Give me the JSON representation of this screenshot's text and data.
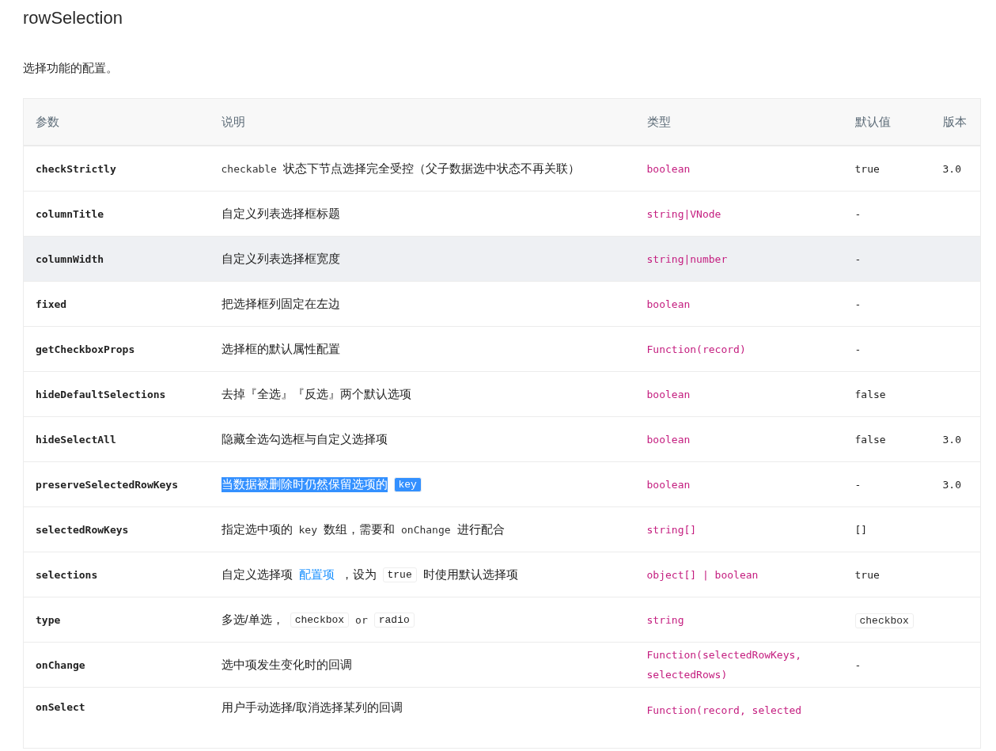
{
  "heading": "rowSelection",
  "intro": "选择功能的配置。",
  "table": {
    "columns": [
      "参数",
      "说明",
      "类型",
      "默认值",
      "版本"
    ],
    "rows": [
      {
        "name": "checkStrictly",
        "description": [
          {
            "kind": "code",
            "text": "checkable"
          },
          {
            "kind": "text",
            "text": "状态下节点选择完全受控（父子数据选中状态不再关联）"
          }
        ],
        "type": "boolean",
        "default": {
          "kind": "text",
          "text": "true"
        },
        "version": "3.0",
        "hovered": false,
        "highlighted": false
      },
      {
        "name": "columnTitle",
        "description": [
          {
            "kind": "text",
            "text": "自定义列表选择框标题"
          }
        ],
        "type": "string|VNode",
        "default": {
          "kind": "text",
          "text": "-"
        },
        "hovered": false,
        "highlighted": false
      },
      {
        "name": "columnWidth",
        "description": [
          {
            "kind": "text",
            "text": "自定义列表选择框宽度"
          }
        ],
        "type": "string|number",
        "default": {
          "kind": "text",
          "text": "-"
        },
        "hovered": true,
        "highlighted": false
      },
      {
        "name": "fixed",
        "description": [
          {
            "kind": "text",
            "text": "把选择框列固定在左边"
          }
        ],
        "type": "boolean",
        "default": {
          "kind": "text",
          "text": "-"
        },
        "hovered": false,
        "highlighted": false
      },
      {
        "name": "getCheckboxProps",
        "description": [
          {
            "kind": "text",
            "text": "选择框的默认属性配置"
          }
        ],
        "type": "Function(record)",
        "default": {
          "kind": "text",
          "text": "-"
        },
        "hovered": false,
        "highlighted": false
      },
      {
        "name": "hideDefaultSelections",
        "description": [
          {
            "kind": "text",
            "text": "去掉『全选』『反选』两个默认选项"
          }
        ],
        "type": "boolean",
        "default": {
          "kind": "text",
          "text": "false"
        },
        "hovered": false,
        "highlighted": false
      },
      {
        "name": "hideSelectAll",
        "description": [
          {
            "kind": "text",
            "text": "隐藏全选勾选框与自定义选择项"
          }
        ],
        "type": "boolean",
        "default": {
          "kind": "text",
          "text": "false"
        },
        "version": "3.0",
        "hovered": false,
        "highlighted": false
      },
      {
        "name": "preserveSelectedRowKeys",
        "description": [
          {
            "kind": "text",
            "text": "当数据被删除时仍然保留选项的"
          },
          {
            "kind": "tag",
            "text": "key"
          }
        ],
        "type": "boolean",
        "default": {
          "kind": "text",
          "text": "-"
        },
        "version": "3.0",
        "hovered": false,
        "highlighted": true
      },
      {
        "name": "selectedRowKeys",
        "description": [
          {
            "kind": "text",
            "text": "指定选中项的"
          },
          {
            "kind": "code",
            "text": "key"
          },
          {
            "kind": "text",
            "text": "数组，需要和"
          },
          {
            "kind": "code",
            "text": "onChange"
          },
          {
            "kind": "text",
            "text": "进行配合"
          }
        ],
        "type": "string[]",
        "default": {
          "kind": "text",
          "text": "[]"
        },
        "hovered": false,
        "highlighted": false
      },
      {
        "name": "selections",
        "description": [
          {
            "kind": "text",
            "text": "自定义选择项"
          },
          {
            "kind": "link",
            "text": "配置项"
          },
          {
            "kind": "text",
            "text": "，设为"
          },
          {
            "kind": "tag",
            "text": "true"
          },
          {
            "kind": "text",
            "text": "时使用默认选择项"
          }
        ],
        "type": "object[] | boolean",
        "default": {
          "kind": "text",
          "text": "true"
        },
        "hovered": false,
        "highlighted": false
      },
      {
        "name": "type",
        "description": [
          {
            "kind": "text",
            "text": "多选/单选，"
          },
          {
            "kind": "tag",
            "text": "checkbox"
          },
          {
            "kind": "code",
            "text": "or"
          },
          {
            "kind": "tag",
            "text": "radio"
          }
        ],
        "type": "string",
        "default": {
          "kind": "tag",
          "text": "checkbox"
        },
        "hovered": false,
        "highlighted": false
      },
      {
        "name": "onChange",
        "description": [
          {
            "kind": "text",
            "text": "选中项发生变化时的回调"
          }
        ],
        "type": "Function(selectedRowKeys, selectedRows)",
        "default": {
          "kind": "text",
          "text": "-"
        },
        "hovered": false,
        "highlighted": false
      },
      {
        "name": "onSelect",
        "description": [
          {
            "kind": "text",
            "text": "用户手动选择/取消选择某列的回调"
          }
        ],
        "type": "Function(record, selected",
        "hovered": false,
        "highlighted": false
      }
    ]
  }
}
